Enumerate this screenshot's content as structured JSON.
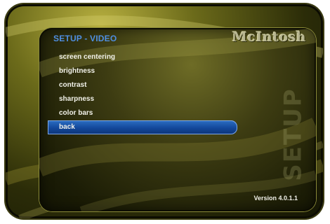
{
  "brand": {
    "logo_text": "McIntosh"
  },
  "screen": {
    "title": "SETUP - VIDEO",
    "watermark": "SETUP",
    "version": "Version 4.0.1.1"
  },
  "menu": {
    "items": [
      {
        "label": "screen centering",
        "selected": false
      },
      {
        "label": "brightness",
        "selected": false
      },
      {
        "label": "contrast",
        "selected": false
      },
      {
        "label": "sharpness",
        "selected": false
      },
      {
        "label": "color bars",
        "selected": false
      },
      {
        "label": "back",
        "selected": true
      }
    ]
  },
  "colors": {
    "title_blue": "#4f8ee0",
    "selection_blue": "#13479a",
    "frame_gold": "#b8b040",
    "frame_dark": "#141504",
    "text_white": "#f2f2ea"
  }
}
